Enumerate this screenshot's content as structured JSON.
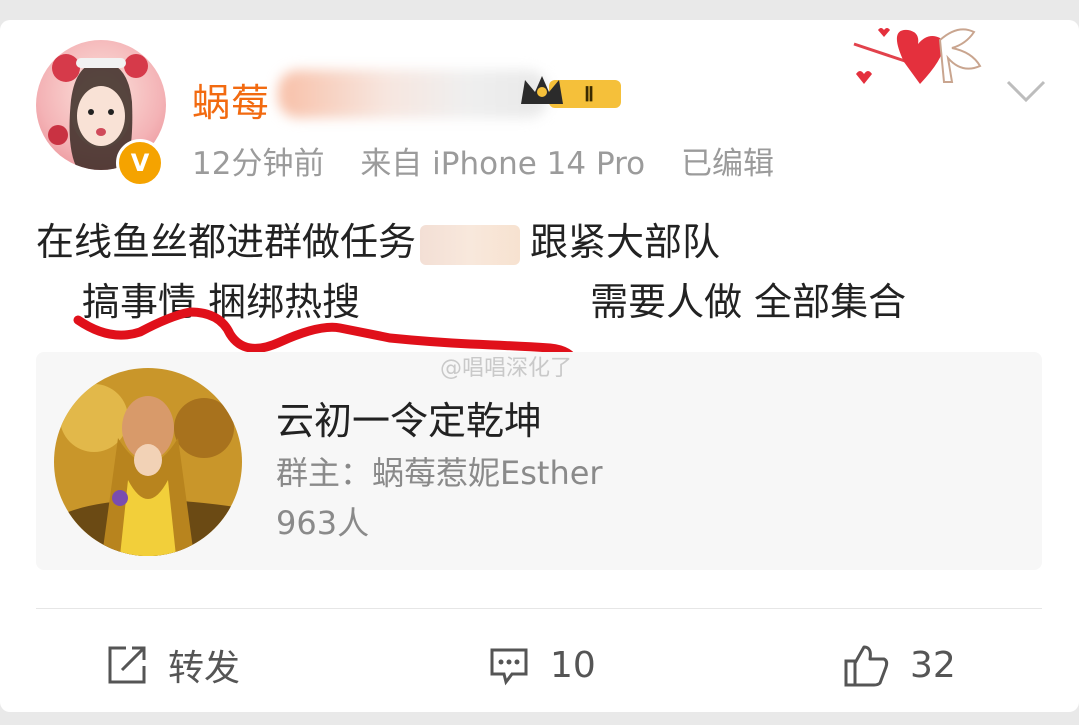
{
  "post": {
    "username_visible": "蜗莓",
    "level_badge": "Ⅱ",
    "time": "12分钟前",
    "source": "来自 iPhone 14 Pro",
    "edited": "已编辑",
    "verified_mark": "V",
    "text_line1_a": "在线鱼丝都进群做任务",
    "text_line1_b": "跟紧大部队",
    "text_line2_a": "搞事情 捆绑热搜",
    "text_line2_b": "需要人做 全部集合"
  },
  "group": {
    "name": "云初一令定乾坤",
    "owner": "群主：蜗莓惹妮Esther",
    "members": "963人"
  },
  "watermark": "@唱唱深化了",
  "actions": {
    "repost_label": "转发",
    "comment_count": "10",
    "like_count": "32"
  },
  "icons": {
    "repost": "repost-icon",
    "comment": "comment-icon",
    "like": "thumbs-up-icon",
    "more": "chevron-down-icon",
    "verified": "verified-badge-icon",
    "crown": "crown-badge-icon"
  },
  "colors": {
    "username": "#f26a10",
    "meta": "#9b9b9b",
    "scribble": "#e0101a",
    "verified": "#f5a300"
  }
}
